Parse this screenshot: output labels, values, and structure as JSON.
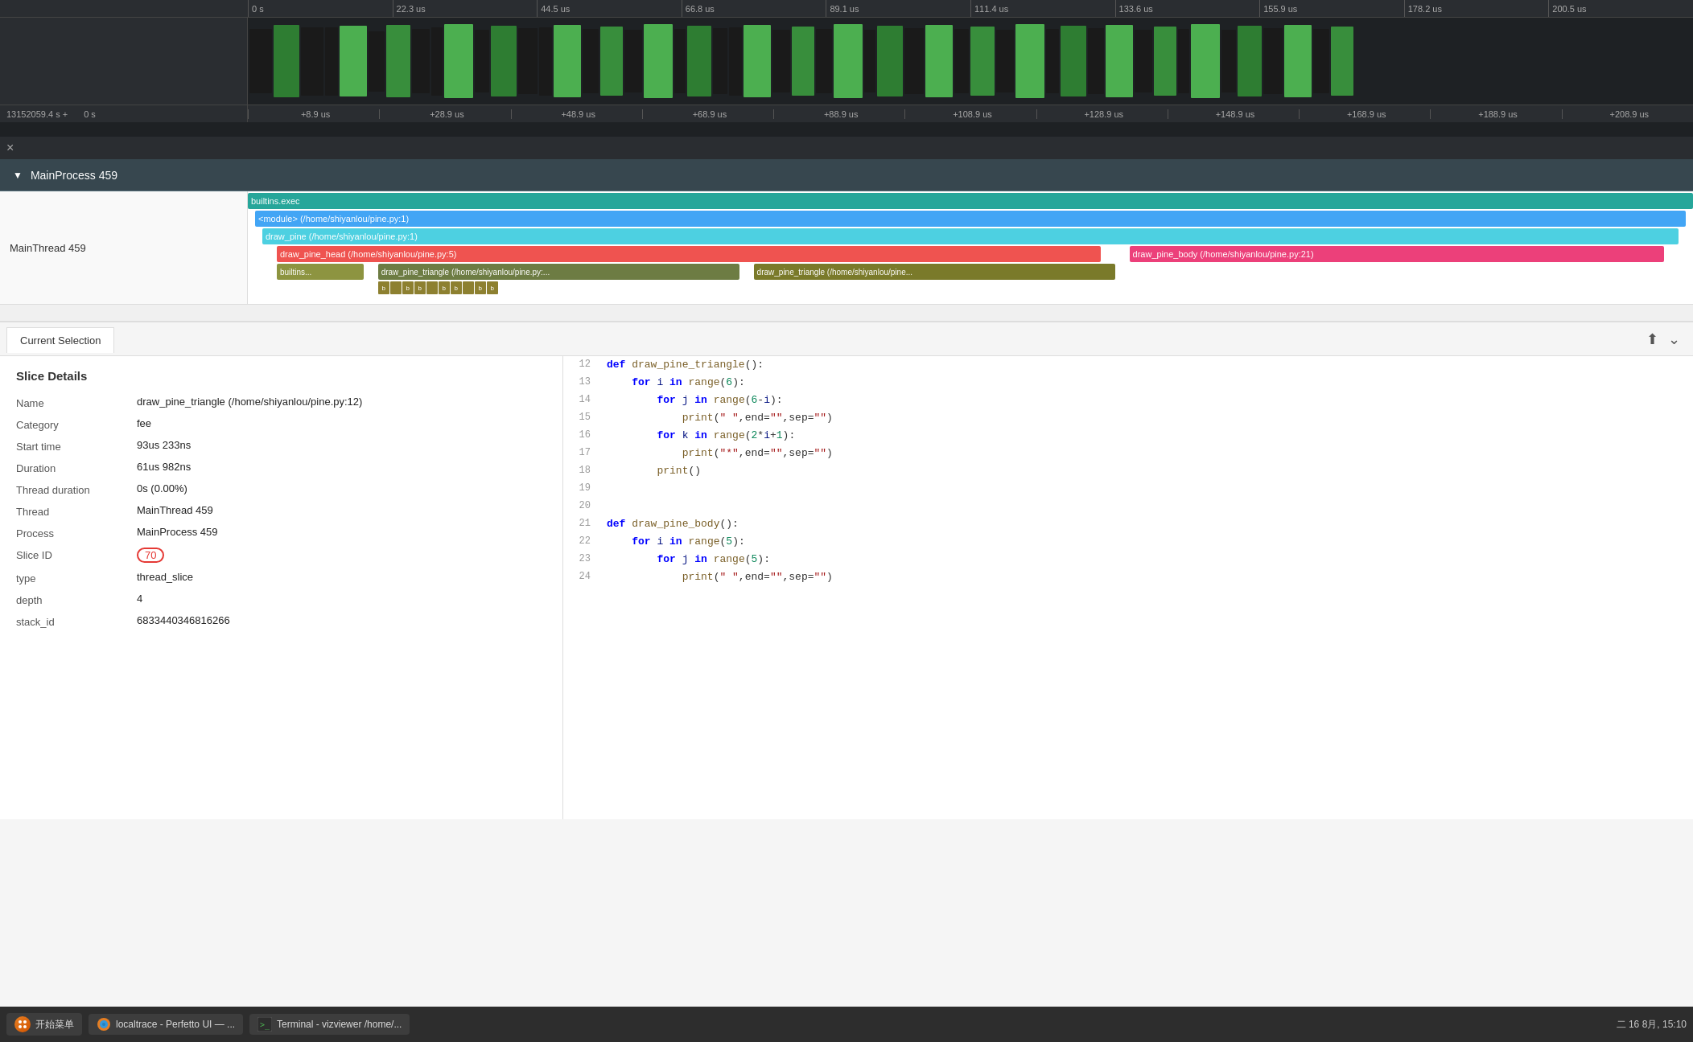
{
  "timeline": {
    "ruler_top": {
      "ticks": [
        "0 s",
        "22.3 us",
        "44.5 us",
        "66.8 us",
        "89.1 us",
        "111.4 us",
        "133.6 us",
        "155.9 us",
        "178.2 us",
        "200.5 us"
      ]
    },
    "ruler_bottom": {
      "left_label": "13152059.4 s +",
      "left_zero": "0 s",
      "ticks": [
        "+8.9 us",
        "+28.9 us",
        "+48.9 us",
        "+68.9 us",
        "+88.9 us",
        "+108.9 us",
        "+128.9 us",
        "+148.9 us",
        "+168.9 us",
        "+188.9 us",
        "+208.9 us"
      ]
    }
  },
  "collapse_row": {
    "icon": "×"
  },
  "process": {
    "name": "MainProcess 459",
    "thread_name": "MainThread 459"
  },
  "trace_bars": {
    "row1": {
      "label": "builtins.exec",
      "color": "bar-teal",
      "left": "0%",
      "width": "100%"
    },
    "row2": {
      "label": "<module> (/home/shiyanlou/pine.py:1)",
      "color": "bar-blue",
      "left": "1%",
      "width": "98%"
    },
    "row3": {
      "label": "draw_pine (/home/shiyanlou/pine.py:1)",
      "color": "bar-cyan",
      "left": "2%",
      "width": "96%"
    },
    "row4": {
      "label": "draw_pine_head (/home/shiyanlou/pine.py:5)",
      "color": "bar-red",
      "left": "3%",
      "width": "58%"
    },
    "row4b": {
      "label": "draw_pine_body (/home/shiyanlou/pine.py:21)",
      "color": "bar-pink",
      "left": "62%",
      "width": "36%"
    },
    "row5a": {
      "label": "builtins...",
      "color": "bar-olive",
      "left": "3%",
      "width": "5%"
    },
    "row5b": {
      "label": "draw_pine_triangle (/home/shiyanlou/pine.py:...",
      "color": "bar-dark-olive",
      "left": "10%",
      "width": "24%"
    },
    "row5c": {
      "label": "draw_pine_triangle (/home/shiyanlou/pine...",
      "color": "bar-darker-olive",
      "left": "36%",
      "width": "24%"
    }
  },
  "panel": {
    "tab_label": "Current Selection",
    "icon_pin": "⬆",
    "icon_expand": "⌄"
  },
  "slice_details": {
    "title": "Slice Details",
    "fields": {
      "name_label": "Name",
      "name_value": "draw_pine_triangle (/home/shiyanlou/pine.py:12)",
      "category_label": "Category",
      "category_value": "fee",
      "start_time_label": "Start time",
      "start_time_value": "93us 233ns",
      "duration_label": "Duration",
      "duration_value": "61us 982ns",
      "thread_duration_label": "Thread duration",
      "thread_duration_value": "0s (0.00%)",
      "thread_label": "Thread",
      "thread_value": "MainThread 459",
      "process_label": "Process",
      "process_value": "MainProcess 459",
      "slice_id_label": "Slice ID",
      "slice_id_value": "70",
      "type_label": "type",
      "type_value": "thread_slice",
      "depth_label": "depth",
      "depth_value": "4",
      "stack_id_label": "stack_id",
      "stack_id_value": "6833440346816266"
    }
  },
  "code": {
    "lines": [
      {
        "num": "12",
        "content": "def draw_pine_triangle():"
      },
      {
        "num": "13",
        "content": "    for i in range(6):"
      },
      {
        "num": "14",
        "content": "        for j in range(6-i):"
      },
      {
        "num": "15",
        "content": "            print(\" \",end=\"\",sep=\"\")"
      },
      {
        "num": "16",
        "content": "        for k in range(2*i+1):"
      },
      {
        "num": "17",
        "content": "            print(\"*\",end=\"\",sep=\"\")"
      },
      {
        "num": "18",
        "content": "        print()"
      },
      {
        "num": "19",
        "content": ""
      },
      {
        "num": "20",
        "content": ""
      },
      {
        "num": "21",
        "content": "def draw_pine_body():"
      },
      {
        "num": "22",
        "content": "    for i in range(5):"
      },
      {
        "num": "23",
        "content": "        for j in range(5):"
      },
      {
        "num": "24",
        "content": "            print(\" \",end=\"\",sep=\"\")"
      }
    ]
  },
  "taskbar": {
    "start_label": "开始菜单",
    "firefox_label": "localtrace - Perfetto UI — ...",
    "terminal_label": "Terminal - vizviewer /home/...",
    "datetime": "二 16 8月, 15:10"
  }
}
